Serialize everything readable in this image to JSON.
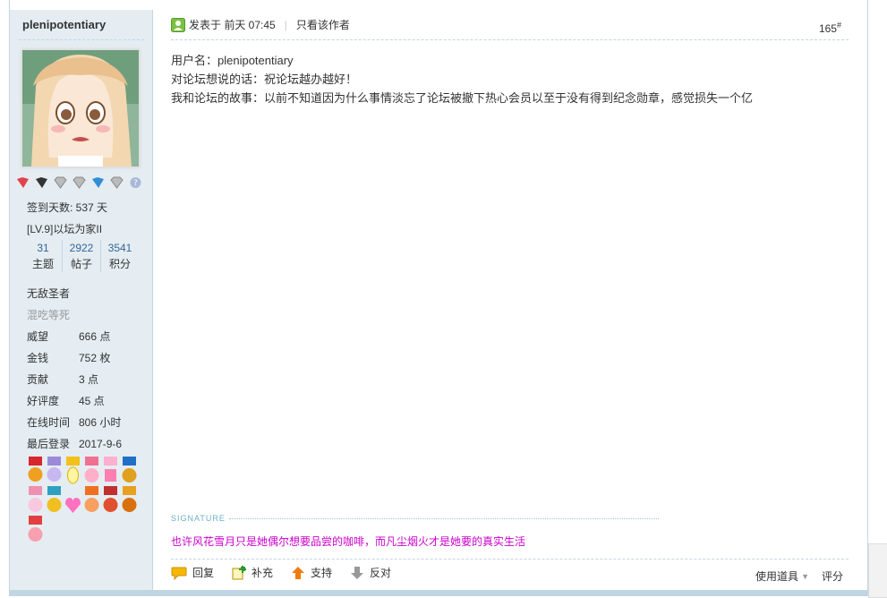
{
  "author": {
    "name": "plenipotentiary"
  },
  "signin": {
    "label": "签到天数: 537 天"
  },
  "level": {
    "label": "[LV.9]以坛为家II"
  },
  "stats": [
    {
      "num": "31",
      "label": "主题"
    },
    {
      "num": "2922",
      "label": "帖子"
    },
    {
      "num": "3541",
      "label": "积分"
    }
  ],
  "titles": {
    "title1": "无敌圣者",
    "title2": "混吃等死"
  },
  "profile_rows": [
    {
      "k": "威望",
      "v": "666 点"
    },
    {
      "k": "金钱",
      "v": "752 枚"
    },
    {
      "k": "贡献",
      "v": "3 点"
    },
    {
      "k": "好评度",
      "v": "45 点"
    },
    {
      "k": "在线时间",
      "v": "806 小时"
    },
    {
      "k": "最后登录",
      "v": "2017-9-6"
    }
  ],
  "post": {
    "posted_at": "发表于 前天 07:45",
    "only_author": "只看该作者",
    "floor": "165",
    "floor_mark": "#",
    "lines": [
      "用户名：plenipotentiary",
      "对论坛想说的话：祝论坛越办越好！",
      "我和论坛的故事：以前不知道因为什么事情淡忘了论坛被撤下热心会员以至于没有得到纪念勋章，感觉损失一个亿"
    ],
    "signature_label": "SIGNATURE",
    "signature": "也许风花雪月只是她偶尔想要品尝的咖啡，而凡尘烟火才是她要的真实生活"
  },
  "actions": {
    "reply": "回复",
    "supplement": "补充",
    "support": "支持",
    "oppose": "反对",
    "use_tool": "使用道具",
    "rate": "评分"
  },
  "colors": {
    "accent": "#336699",
    "sidebar_bg": "#e5edf2",
    "border": "#c2d5e3",
    "signature": "#cc00cc"
  }
}
